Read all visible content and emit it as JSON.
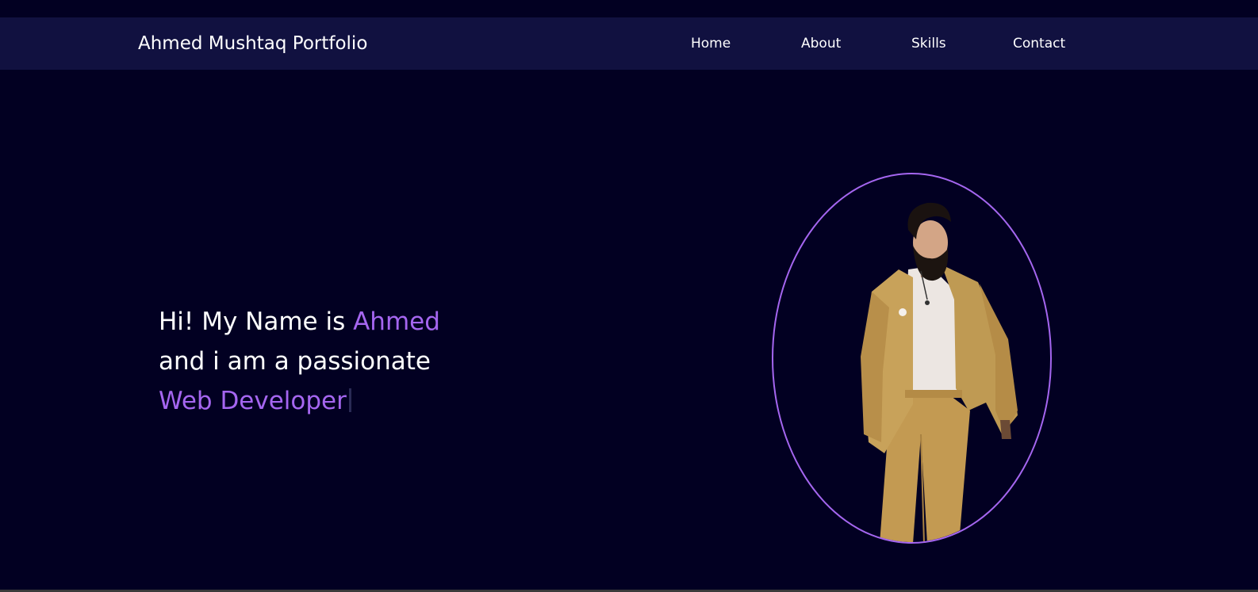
{
  "navbar": {
    "brand": "Ahmed Mushtaq Portfolio",
    "links": [
      {
        "label": "Home"
      },
      {
        "label": "About"
      },
      {
        "label": "Skills"
      },
      {
        "label": "Contact"
      }
    ]
  },
  "hero": {
    "line1_prefix": "Hi! My Name is ",
    "line1_name": "Ahmed",
    "line2": "and i am a passionate",
    "line3_role": "Web Developer"
  },
  "colors": {
    "background": "#020022",
    "navbar": "#111140",
    "accent": "#a566f0",
    "text": "#ffffff"
  },
  "icons": {
    "portrait": "person-in-tan-suit-photo"
  }
}
